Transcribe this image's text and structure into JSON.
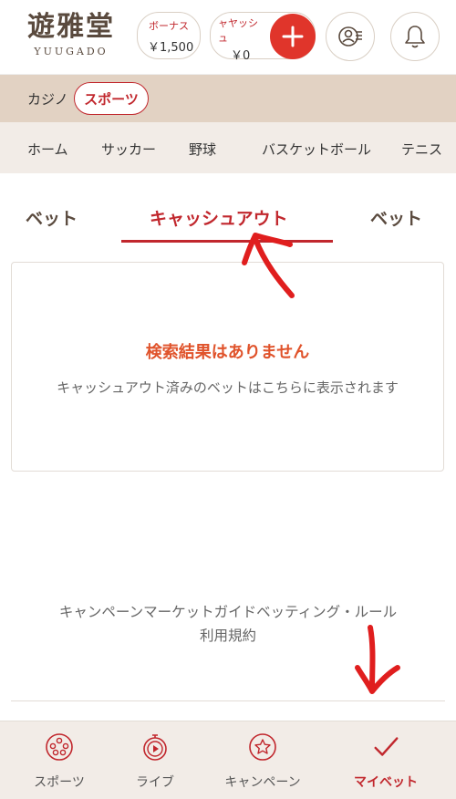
{
  "header": {
    "logo_main": "遊雅堂",
    "logo_sub": "YUUGADO",
    "bonus_label": "ボーナス",
    "bonus_value": "￥1,500",
    "cash_label": "ャヤッシュ",
    "cash_value": "￥0"
  },
  "categories": {
    "casino": "カジノ",
    "sports": "スポーツ"
  },
  "sport_nav": [
    "ホーム",
    "サッカー",
    "野球",
    "バスケットボール",
    "テニス"
  ],
  "tabs": {
    "left": "ベット",
    "active": "キャッシュアウト",
    "right": "ベット"
  },
  "empty": {
    "title": "検索結果はありません",
    "subtitle": "キャッシュアウト済みのベットはこちらに表示されます"
  },
  "footer_links": {
    "line1": "キャンペーンマーケットガイドベッティング・ルール",
    "line2": "利用規約"
  },
  "bottom_nav": [
    {
      "label": "スポーツ",
      "icon": "soccer-ball-icon"
    },
    {
      "label": "ライブ",
      "icon": "live-stopwatch-icon"
    },
    {
      "label": "キャンペーン",
      "icon": "star-badge-icon"
    },
    {
      "label": "マイベット",
      "icon": "checkmark-icon"
    }
  ],
  "colors": {
    "accent": "#c1272d",
    "beige": "#e2d2c3",
    "light": "#f2ece7"
  }
}
